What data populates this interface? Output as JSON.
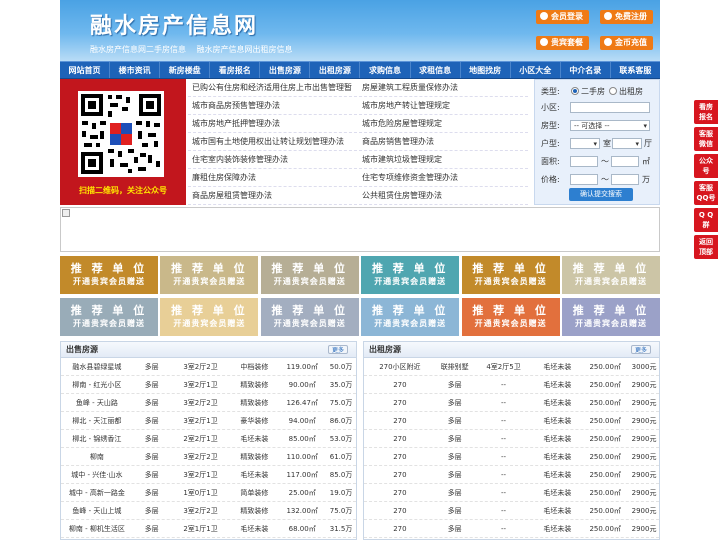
{
  "header": {
    "title": "融水房产信息网",
    "links": [
      "融水房产信息网二手房信息",
      "融水房产信息网出租房信息"
    ],
    "buttons": [
      "会员登录",
      "免费注册",
      "贵宾套餐",
      "金币充值"
    ]
  },
  "nav": [
    "网站首页",
    "楼市资讯",
    "新房楼盘",
    "看房报名",
    "出售房源",
    "出租房源",
    "求购信息",
    "求租信息",
    "地图找房",
    "小区大全",
    "中介名录",
    "联系客服"
  ],
  "qr": {
    "caption": "扫描二维码，关注公众号"
  },
  "articles": [
    [
      "已购公有住房和经济适用住房上市出售管理暂",
      "房屋建筑工程质量保修办法"
    ],
    [
      "城市商品房预售管理办法",
      "城市房地产转让管理规定"
    ],
    [
      "城市房地产抵押管理办法",
      "城市危险房屋管理规定"
    ],
    [
      "城市国有土地使用权出让转让规划管理办法",
      "商品房销售管理办法"
    ],
    [
      "住宅室内装饰装修管理办法",
      "城市建筑垃圾管理规定"
    ],
    [
      "廉租住房保障办法",
      "住宅专项维修资金管理办法"
    ],
    [
      "商品房屋租赁管理办法",
      "公共租赁住房管理办法"
    ]
  ],
  "search": {
    "type_label": "类型:",
    "options": [
      "二手房",
      "出租房"
    ],
    "area_label": "小区:",
    "house_label": "房型:",
    "house_select": "-- 可选择 --",
    "layout_label": "户型:",
    "room_unit": "室",
    "hall_unit": "厅",
    "size_label": "面积:",
    "size_sep": "～",
    "size_unit": "㎡",
    "price_label": "价格:",
    "price_sep": "～",
    "price_unit": "万",
    "submit": "确认提交搜索"
  },
  "tiles": {
    "line1": "推 荐 单 位",
    "line2": "开通贵宾会员赠送",
    "colors": [
      "#c28a2a",
      "#c9b88a",
      "#b6ae95",
      "#4fa6b0",
      "#c28a2a",
      "#ccc5a6",
      "#99acb8",
      "#e8cf97",
      "#a3aec0",
      "#8cb6d6",
      "#e2703d",
      "#9ba1c8"
    ]
  },
  "sale": {
    "title": "出售房源",
    "more": "更多",
    "rows": [
      [
        "融水县碧绿星城",
        "多层",
        "3室2厅2卫",
        "中档装修",
        "119.00㎡",
        "50.0万"
      ],
      [
        "柳南 - 红光小区",
        "多层",
        "3室2厅1卫",
        "精致装修",
        "90.00㎡",
        "35.0万"
      ],
      [
        "鱼峰 - 天山路",
        "多层",
        "3室2厅2卫",
        "精致装修",
        "126.47㎡",
        "75.0万"
      ],
      [
        "柳北 - 天江丽都",
        "多层",
        "3室2厅1卫",
        "豪华装修",
        "94.00㎡",
        "86.0万"
      ],
      [
        "柳北 - 锦绣香江",
        "多层",
        "2室2厅1卫",
        "毛坯未装",
        "85.00㎡",
        "53.0万"
      ],
      [
        "柳南",
        "多层",
        "3室2厅2卫",
        "精致装修",
        "110.00㎡",
        "61.0万"
      ],
      [
        "城中 - 兴佳·山水",
        "多层",
        "3室2厅1卫",
        "毛坯未装",
        "117.00㎡",
        "85.0万"
      ],
      [
        "城中 - 高新一路金",
        "多层",
        "1室0厅1卫",
        "简单装修",
        "25.00㎡",
        "19.0万"
      ],
      [
        "鱼峰 - 天山上城",
        "多层",
        "3室2厅2卫",
        "精致装修",
        "132.00㎡",
        "75.0万"
      ],
      [
        "柳南 - 柳机生活区",
        "多层",
        "2室1厅1卫",
        "毛坯未装",
        "68.00㎡",
        "31.5万"
      ]
    ]
  },
  "rent": {
    "title": "出租房源",
    "more": "更多",
    "rows": [
      [
        "270小区附近",
        "联排别墅",
        "4室2厅5卫",
        "毛坯未装",
        "250.00㎡",
        "3000元"
      ],
      [
        "270",
        "多层",
        "--",
        "毛坯未装",
        "250.00㎡",
        "2900元"
      ],
      [
        "270",
        "多层",
        "--",
        "毛坯未装",
        "250.00㎡",
        "2900元"
      ],
      [
        "270",
        "多层",
        "--",
        "毛坯未装",
        "250.00㎡",
        "2900元"
      ],
      [
        "270",
        "多层",
        "--",
        "毛坯未装",
        "250.00㎡",
        "2900元"
      ],
      [
        "270",
        "多层",
        "--",
        "毛坯未装",
        "250.00㎡",
        "2900元"
      ],
      [
        "270",
        "多层",
        "--",
        "毛坯未装",
        "250.00㎡",
        "2900元"
      ],
      [
        "270",
        "多层",
        "--",
        "毛坯未装",
        "250.00㎡",
        "2900元"
      ],
      [
        "270",
        "多层",
        "--",
        "毛坯未装",
        "250.00㎡",
        "2900元"
      ],
      [
        "270",
        "多层",
        "--",
        "毛坯未装",
        "250.00㎡",
        "2900元"
      ]
    ]
  },
  "float": [
    "看房\n报名",
    "客服\n微信",
    "公众\n号",
    "客服\nQQ号",
    "Q Q\n群",
    "返回\n顶部"
  ]
}
